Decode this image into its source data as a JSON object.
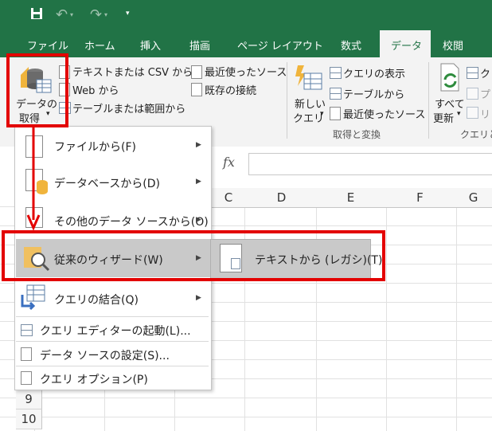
{
  "titlebar": {
    "save_icon": "save-icon",
    "undo_icon": "undo-icon",
    "redo_icon": "redo-icon",
    "customize_icon": "customize-icon"
  },
  "tabs": [
    "ファイル",
    "ホーム",
    "挿入",
    "描画",
    "ページ レイアウト",
    "数式",
    "データ",
    "校閲"
  ],
  "active_tab": "データ",
  "ribbon": {
    "get_data_line1": "データの",
    "get_data_line2": "取得",
    "get_data_arrow": "▾",
    "from_text_csv": "テキストまたは CSV から",
    "from_web": "Web から",
    "from_table": "テーブルまたは範囲から",
    "recent_sources": "最近使ったソース",
    "existing_connections": "既存の接続",
    "new_query_line1": "新しい",
    "new_query_line2": "クエリ",
    "new_query_arrow": "▾",
    "show_queries": "クエリの表示",
    "from_table2": "テーブルから",
    "recent_sources2": "最近使ったソース",
    "group_label": "取得と変換",
    "refresh_line1": "すべて",
    "refresh_line2": "更新",
    "refresh_arrow": "▾",
    "cut_label_right": "クエリと",
    "frag_1": "ク",
    "frag_2": "プ",
    "frag_3": "リ"
  },
  "formula_bar": {
    "fx": "fx"
  },
  "columns": [
    "C",
    "D",
    "E",
    "F",
    "G"
  ],
  "rows": [
    "9",
    "10"
  ],
  "menu": {
    "items": [
      {
        "label": "ファイルから(F)",
        "arrow": "▶"
      },
      {
        "label": "データベースから(D)",
        "arrow": "▶"
      },
      {
        "label": "その他のデータ ソースから(O)",
        "arrow": "▶"
      },
      {
        "label": "従来のウィザード(W)",
        "arrow": "▶"
      },
      {
        "label": "クエリの結合(Q)",
        "arrow": "▶"
      },
      {
        "label": "クエリ エディターの起動(L)..."
      },
      {
        "label": "データ ソースの設定(S)..."
      },
      {
        "label": "クエリ オプション(P)"
      }
    ]
  },
  "submenu": {
    "label": "テキストから (レガシ)(T)"
  },
  "colors": {
    "excel_green": "#217346",
    "highlight_red": "#e30000"
  }
}
